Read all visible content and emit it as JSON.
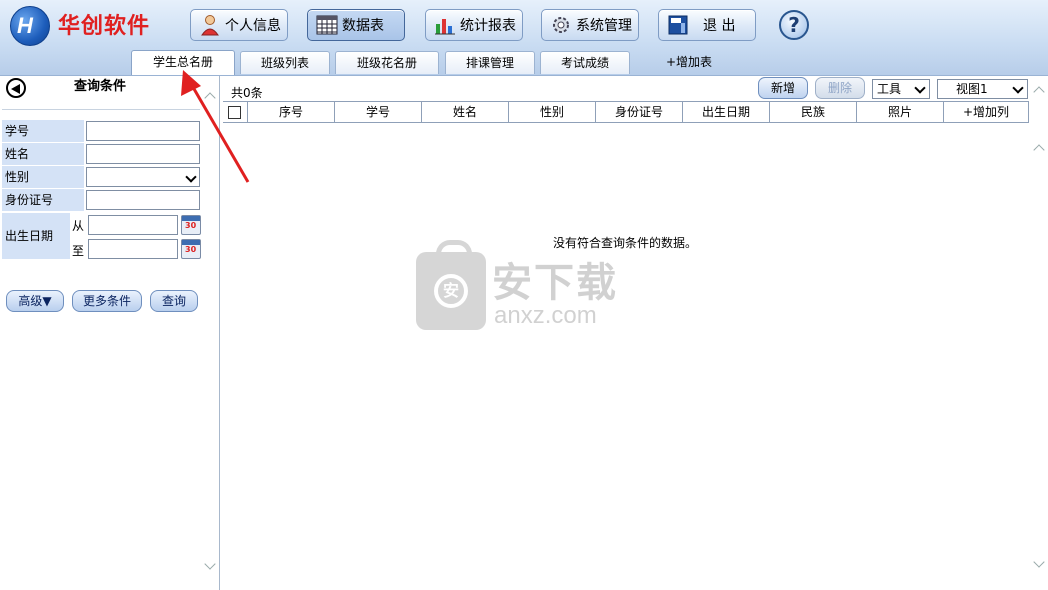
{
  "header": {
    "brand": "华创软件",
    "logo_text": "H",
    "buttons": [
      {
        "label": "个人信息",
        "icon": "person-icon"
      },
      {
        "label": "数据表",
        "icon": "table-grid-icon",
        "active": true
      },
      {
        "label": "统计报表",
        "icon": "bar-chart-icon"
      },
      {
        "label": "系统管理",
        "icon": "gear-icon"
      },
      {
        "label": "退  出",
        "icon": "exit-icon"
      }
    ],
    "help": "?"
  },
  "tabs": [
    "学生总名册",
    "班级列表",
    "班级花名册",
    "排课管理",
    "考试成绩",
    "+增加表"
  ],
  "query": {
    "title": "查询条件",
    "fields": [
      "学号",
      "姓名",
      "性别",
      "身份证号"
    ],
    "birth_label": "出生日期",
    "from": "从",
    "to": "至",
    "calendar_text": "30",
    "buttons": [
      "高级▼",
      "更多条件",
      "查询"
    ]
  },
  "grid": {
    "count": "共0条",
    "new_btn": "新增",
    "delete_btn": "删除",
    "tools": "工具",
    "view": "视图1",
    "columns": [
      "序号",
      "学号",
      "姓名",
      "性别",
      "身份证号",
      "出生日期",
      "民族",
      "照片",
      "+增加列"
    ],
    "empty_message": "没有符合查询条件的数据。"
  },
  "watermark": {
    "cn": "安下载",
    "en": "anxz.com",
    "bag_char": "安"
  },
  "colors": {
    "brand": "#e02020",
    "header_bg": "#c9dcf2",
    "label_bg": "#d4e2f6",
    "arrow": "#e02020"
  }
}
